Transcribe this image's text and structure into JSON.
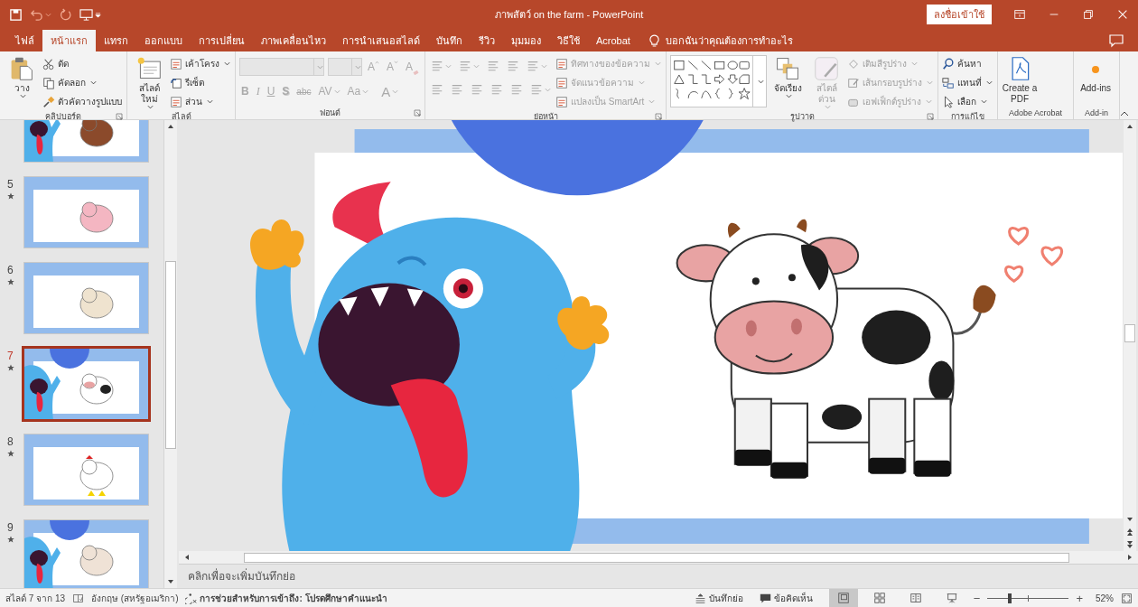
{
  "window": {
    "title": "ภาพสัตว์ on the farm  -  PowerPoint",
    "sign_in": "ลงชื่อเข้าใช้"
  },
  "tabs": [
    {
      "label": "ไฟล์",
      "selected": false
    },
    {
      "label": "หน้าแรก",
      "selected": true
    },
    {
      "label": "แทรก",
      "selected": false
    },
    {
      "label": "ออกแบบ",
      "selected": false
    },
    {
      "label": "การเปลี่ยน",
      "selected": false
    },
    {
      "label": "ภาพเคลื่อนไหว",
      "selected": false
    },
    {
      "label": "การนำเสนอสไลด์",
      "selected": false
    },
    {
      "label": "บันทึก",
      "selected": false
    },
    {
      "label": "รีวิว",
      "selected": false
    },
    {
      "label": "มุมมอง",
      "selected": false
    },
    {
      "label": "วิธีใช้",
      "selected": false
    },
    {
      "label": "Acrobat",
      "selected": false
    }
  ],
  "tell_me": {
    "placeholder": "บอกฉันว่าคุณต้องการทำอะไร"
  },
  "ribbon": {
    "groups": [
      {
        "label": "คลิปบอร์ด",
        "launcher": true,
        "sections": [
          {
            "kind": "stack",
            "items": [
              {
                "kind": "large",
                "label": "วาง",
                "has_menu": true,
                "disabled": false
              }
            ]
          },
          {
            "kind": "stack",
            "items": [
              {
                "kind": "small",
                "label": "ตัด",
                "has_menu": false,
                "disabled": false
              },
              {
                "kind": "small",
                "label": "คัดลอก",
                "has_menu": true,
                "disabled": false
              },
              {
                "kind": "small",
                "label": "ตัวคัดวางรูปแบบ",
                "has_menu": false,
                "disabled": false
              }
            ]
          }
        ]
      },
      {
        "label": "สไลด์",
        "launcher": false,
        "sections": [
          {
            "kind": "stack",
            "items": [
              {
                "kind": "large",
                "label": "สไลด์ ใหม่",
                "has_menu": true,
                "disabled": false
              }
            ]
          },
          {
            "kind": "stack",
            "items": [
              {
                "kind": "small",
                "label": "เค้าโครง",
                "has_menu": true,
                "disabled": false
              },
              {
                "kind": "small",
                "label": "รีเซ็ต",
                "has_menu": false,
                "disabled": false
              },
              {
                "kind": "small",
                "label": "ส่วน",
                "has_menu": true,
                "disabled": false
              }
            ]
          }
        ]
      },
      {
        "label": "ฟอนต์",
        "launcher": true,
        "sections": [
          {
            "kind": "grid",
            "rows": [
              [
                {
                  "kind": "namefield",
                  "has_menu": true,
                  "disabled": true
                },
                {
                  "kind": "sizefield",
                  "has_menu": true,
                  "disabled": true
                },
                {
                  "kind": "glyph",
                  "text": "A",
                  "has_menu": false,
                  "disabled": true
                },
                {
                  "kind": "glyph",
                  "text": "A",
                  "has_menu": false,
                  "disabled": true
                },
                {
                  "kind": "glyph",
                  "text": "A",
                  "has_menu": false,
                  "disabled": true
                }
              ],
              [
                {
                  "kind": "glyph",
                  "text": "B",
                  "has_menu": false,
                  "disabled": true
                },
                {
                  "kind": "glyph",
                  "text": "I",
                  "has_menu": false,
                  "disabled": true
                },
                {
                  "kind": "glyph",
                  "text": "U",
                  "has_menu": false,
                  "disabled": true
                },
                {
                  "kind": "glyph",
                  "text": "S",
                  "has_menu": false,
                  "disabled": true
                },
                {
                  "kind": "glyph",
                  "text": "abc",
                  "has_menu": false,
                  "disabled": true
                },
                {
                  "kind": "glyph",
                  "text": "AV",
                  "has_menu": true,
                  "disabled": true
                },
                {
                  "kind": "glyph",
                  "text": "Aa",
                  "has_menu": true,
                  "disabled": true
                },
                {
                  "kind": "glyph",
                  "text": "A",
                  "has_menu": true,
                  "disabled": true
                }
              ]
            ]
          }
        ]
      },
      {
        "label": "ย่อหน้า",
        "launcher": true,
        "sections": [
          {
            "kind": "grid",
            "rows": [
              [
                {
                  "kind": "icon",
                  "has_menu": true,
                  "disabled": true
                },
                {
                  "kind": "icon",
                  "has_menu": true,
                  "disabled": true
                },
                {
                  "kind": "icon",
                  "has_menu": false,
                  "disabled": true
                },
                {
                  "kind": "icon",
                  "has_menu": false,
                  "disabled": true
                },
                {
                  "kind": "icon",
                  "has_menu": true,
                  "disabled": true
                }
              ],
              [
                {
                  "kind": "icon",
                  "has_menu": false,
                  "disabled": true
                },
                {
                  "kind": "icon",
                  "has_menu": false,
                  "disabled": true
                },
                {
                  "kind": "icon",
                  "has_menu": false,
                  "disabled": true
                },
                {
                  "kind": "icon",
                  "has_menu": false,
                  "disabled": true
                },
                {
                  "kind": "icon",
                  "has_menu": false,
                  "disabled": true
                },
                {
                  "kind": "icon",
                  "has_menu": true,
                  "disabled": true
                }
              ]
            ]
          },
          {
            "kind": "stack",
            "items": [
              {
                "kind": "small",
                "label": "ทิศทางของข้อความ",
                "has_menu": true,
                "disabled": true
              },
              {
                "kind": "small",
                "label": "จัดแนวข้อความ",
                "has_menu": true,
                "disabled": true
              },
              {
                "kind": "small",
                "label": "แปลงเป็น SmartArt",
                "has_menu": true,
                "disabled": true
              }
            ]
          }
        ]
      },
      {
        "label": "รูปวาด",
        "launcher": true,
        "sections": [
          {
            "kind": "stack",
            "items": [
              {
                "kind": "gallery",
                "has_menu": true,
                "disabled": false
              }
            ]
          },
          {
            "kind": "stack",
            "items": [
              {
                "kind": "large",
                "label": "จัดเรียง",
                "has_menu": true,
                "disabled": false
              }
            ]
          },
          {
            "kind": "stack",
            "items": [
              {
                "kind": "large",
                "label": "สไตล์ ด่วน",
                "has_menu": true,
                "disabled": true
              }
            ]
          },
          {
            "kind": "stack",
            "items": [
              {
                "kind": "small",
                "label": "เติมสีรูปร่าง",
                "has_menu": true,
                "disabled": true
              },
              {
                "kind": "small",
                "label": "เส้นกรอบรูปร่าง",
                "has_menu": true,
                "disabled": true
              },
              {
                "kind": "small",
                "label": "เอฟเฟ็กต์รูปร่าง",
                "has_menu": true,
                "disabled": true
              }
            ]
          }
        ]
      },
      {
        "label": "การแก้ไข",
        "launcher": false,
        "sections": [
          {
            "kind": "stack",
            "items": [
              {
                "kind": "small",
                "label": "ค้นหา",
                "has_menu": false,
                "disabled": false
              },
              {
                "kind": "small",
                "label": "แทนที่",
                "has_menu": true,
                "disabled": false
              },
              {
                "kind": "small",
                "label": "เลือก",
                "has_menu": true,
                "disabled": false
              }
            ]
          }
        ]
      },
      {
        "label": "Adobe Acrobat",
        "launcher": false,
        "sections": [
          {
            "kind": "stack",
            "items": [
              {
                "kind": "large",
                "label": "Create a PDF",
                "has_menu": false,
                "disabled": false
              }
            ]
          }
        ]
      },
      {
        "label": "Add-in",
        "launcher": false,
        "sections": [
          {
            "kind": "stack",
            "items": [
              {
                "kind": "large",
                "label": "Add-ins",
                "has_menu": false,
                "disabled": false
              }
            ]
          }
        ]
      }
    ]
  },
  "slides": [
    {
      "kind": "horse",
      "selected": false,
      "has_animation": false
    },
    {
      "number": "5",
      "kind": "pig",
      "selected": false,
      "has_animation": true
    },
    {
      "number": "6",
      "kind": "sheep",
      "selected": false,
      "has_animation": true
    },
    {
      "number": "7",
      "kind": "cow",
      "selected": true,
      "has_animation": true
    },
    {
      "number": "8",
      "kind": "chicken",
      "selected": false,
      "has_animation": true
    },
    {
      "number": "9",
      "kind": "cat",
      "selected": false,
      "has_animation": true
    }
  ],
  "notes": {
    "placeholder": "คลิกเพื่อจะเพิ่มบันทึกย่อ"
  },
  "status_bar": {
    "slide_position": "สไลด์ 7 จาก 13",
    "language": "อังกฤษ (สหรัฐอเมริกา)",
    "accessibility": "การช่วยสำหรับการเข้าถึง: โปรดศึกษาคำแนะนำ",
    "notes_button": "บันทึกย่อ",
    "comments_button": "ข้อคิดเห็น",
    "views": [
      {
        "selected": true
      },
      {
        "selected": false
      },
      {
        "selected": false
      },
      {
        "selected": false
      }
    ],
    "zoom": {
      "out": "−",
      "in": "+",
      "level": 0.27,
      "reading": "52%"
    }
  }
}
